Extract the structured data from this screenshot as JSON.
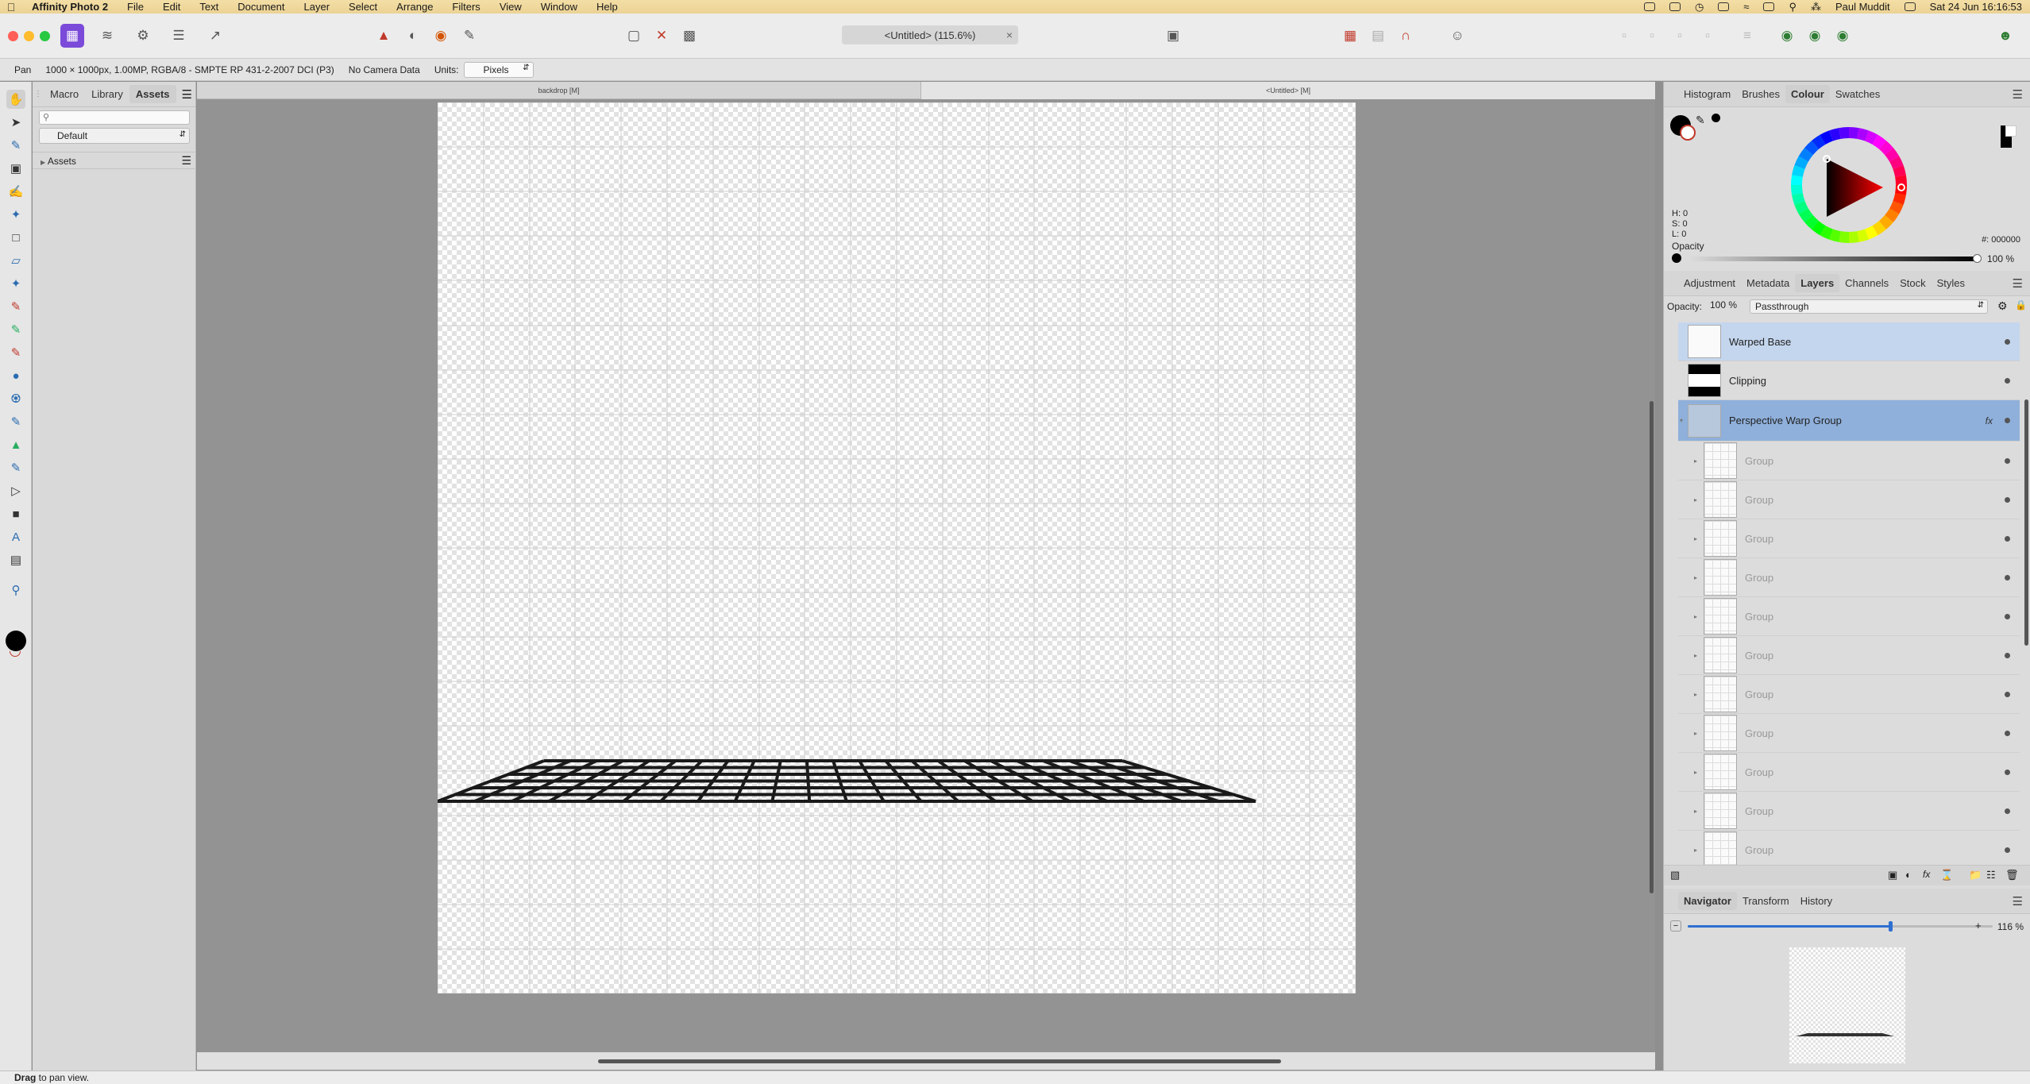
{
  "menubar": {
    "app_name": "Affinity Photo 2",
    "items": [
      "File",
      "Edit",
      "Text",
      "Document",
      "Layer",
      "Select",
      "Arrange",
      "Filters",
      "View",
      "Window",
      "Help"
    ],
    "user": "Paul Muddit",
    "clock": "Sat 24 Jun  16:16:53"
  },
  "toolbar": {
    "doc_title": "<Untitled> (115.6%)",
    "close": "×"
  },
  "context": {
    "tool_name": "Pan",
    "doc_info": "1000 × 1000px, 1.00MP, RGBA/8 - SMPTE RP 431-2-2007 DCI (P3)",
    "camera": "No Camera Data",
    "units_label": "Units:",
    "units_value": "Pixels"
  },
  "left_panel": {
    "tabs": [
      "Macro",
      "Library",
      "Assets"
    ],
    "active_tab": "Assets",
    "search_placeholder": "",
    "category": "Default",
    "section": "Assets"
  },
  "doc_tabs": [
    "backdrop [M]",
    "<Untitled> [M]"
  ],
  "colour_panel": {
    "tabs": [
      "Histogram",
      "Brushes",
      "Colour",
      "Swatches"
    ],
    "active_tab": "Colour",
    "h": "H: 0",
    "s": "S: 0",
    "l": "L: 0",
    "opacity_label": "Opacity",
    "opacity_value": "100 %",
    "hex": "#: 000000"
  },
  "layers_panel": {
    "tabs": [
      "Adjustment",
      "Metadata",
      "Layers",
      "Channels",
      "Stock",
      "Styles"
    ],
    "active_tab": "Layers",
    "opacity_label": "Opacity:",
    "opacity_value": "100 %",
    "blend_mode": "Passthrough",
    "layers": [
      {
        "name": "Warped Base"
      },
      {
        "name": "Clipping"
      },
      {
        "name": "Perspective Warp Group"
      },
      {
        "name": "Group"
      },
      {
        "name": "Group"
      },
      {
        "name": "Group"
      },
      {
        "name": "Group"
      },
      {
        "name": "Group"
      },
      {
        "name": "Group"
      },
      {
        "name": "Group"
      },
      {
        "name": "Group"
      },
      {
        "name": "Group"
      },
      {
        "name": "Group"
      },
      {
        "name": "Group"
      }
    ]
  },
  "navigator_panel": {
    "tabs": [
      "Navigator",
      "Transform",
      "History"
    ],
    "active_tab": "Navigator",
    "zoom": "116 %",
    "minus": "−",
    "plus": "+"
  },
  "status": {
    "bold": "Drag",
    "text": " to pan view."
  },
  "colors": {
    "menubar": "#f0d99f",
    "selection": "#8fb0db",
    "accent": "#2f6fd1"
  }
}
